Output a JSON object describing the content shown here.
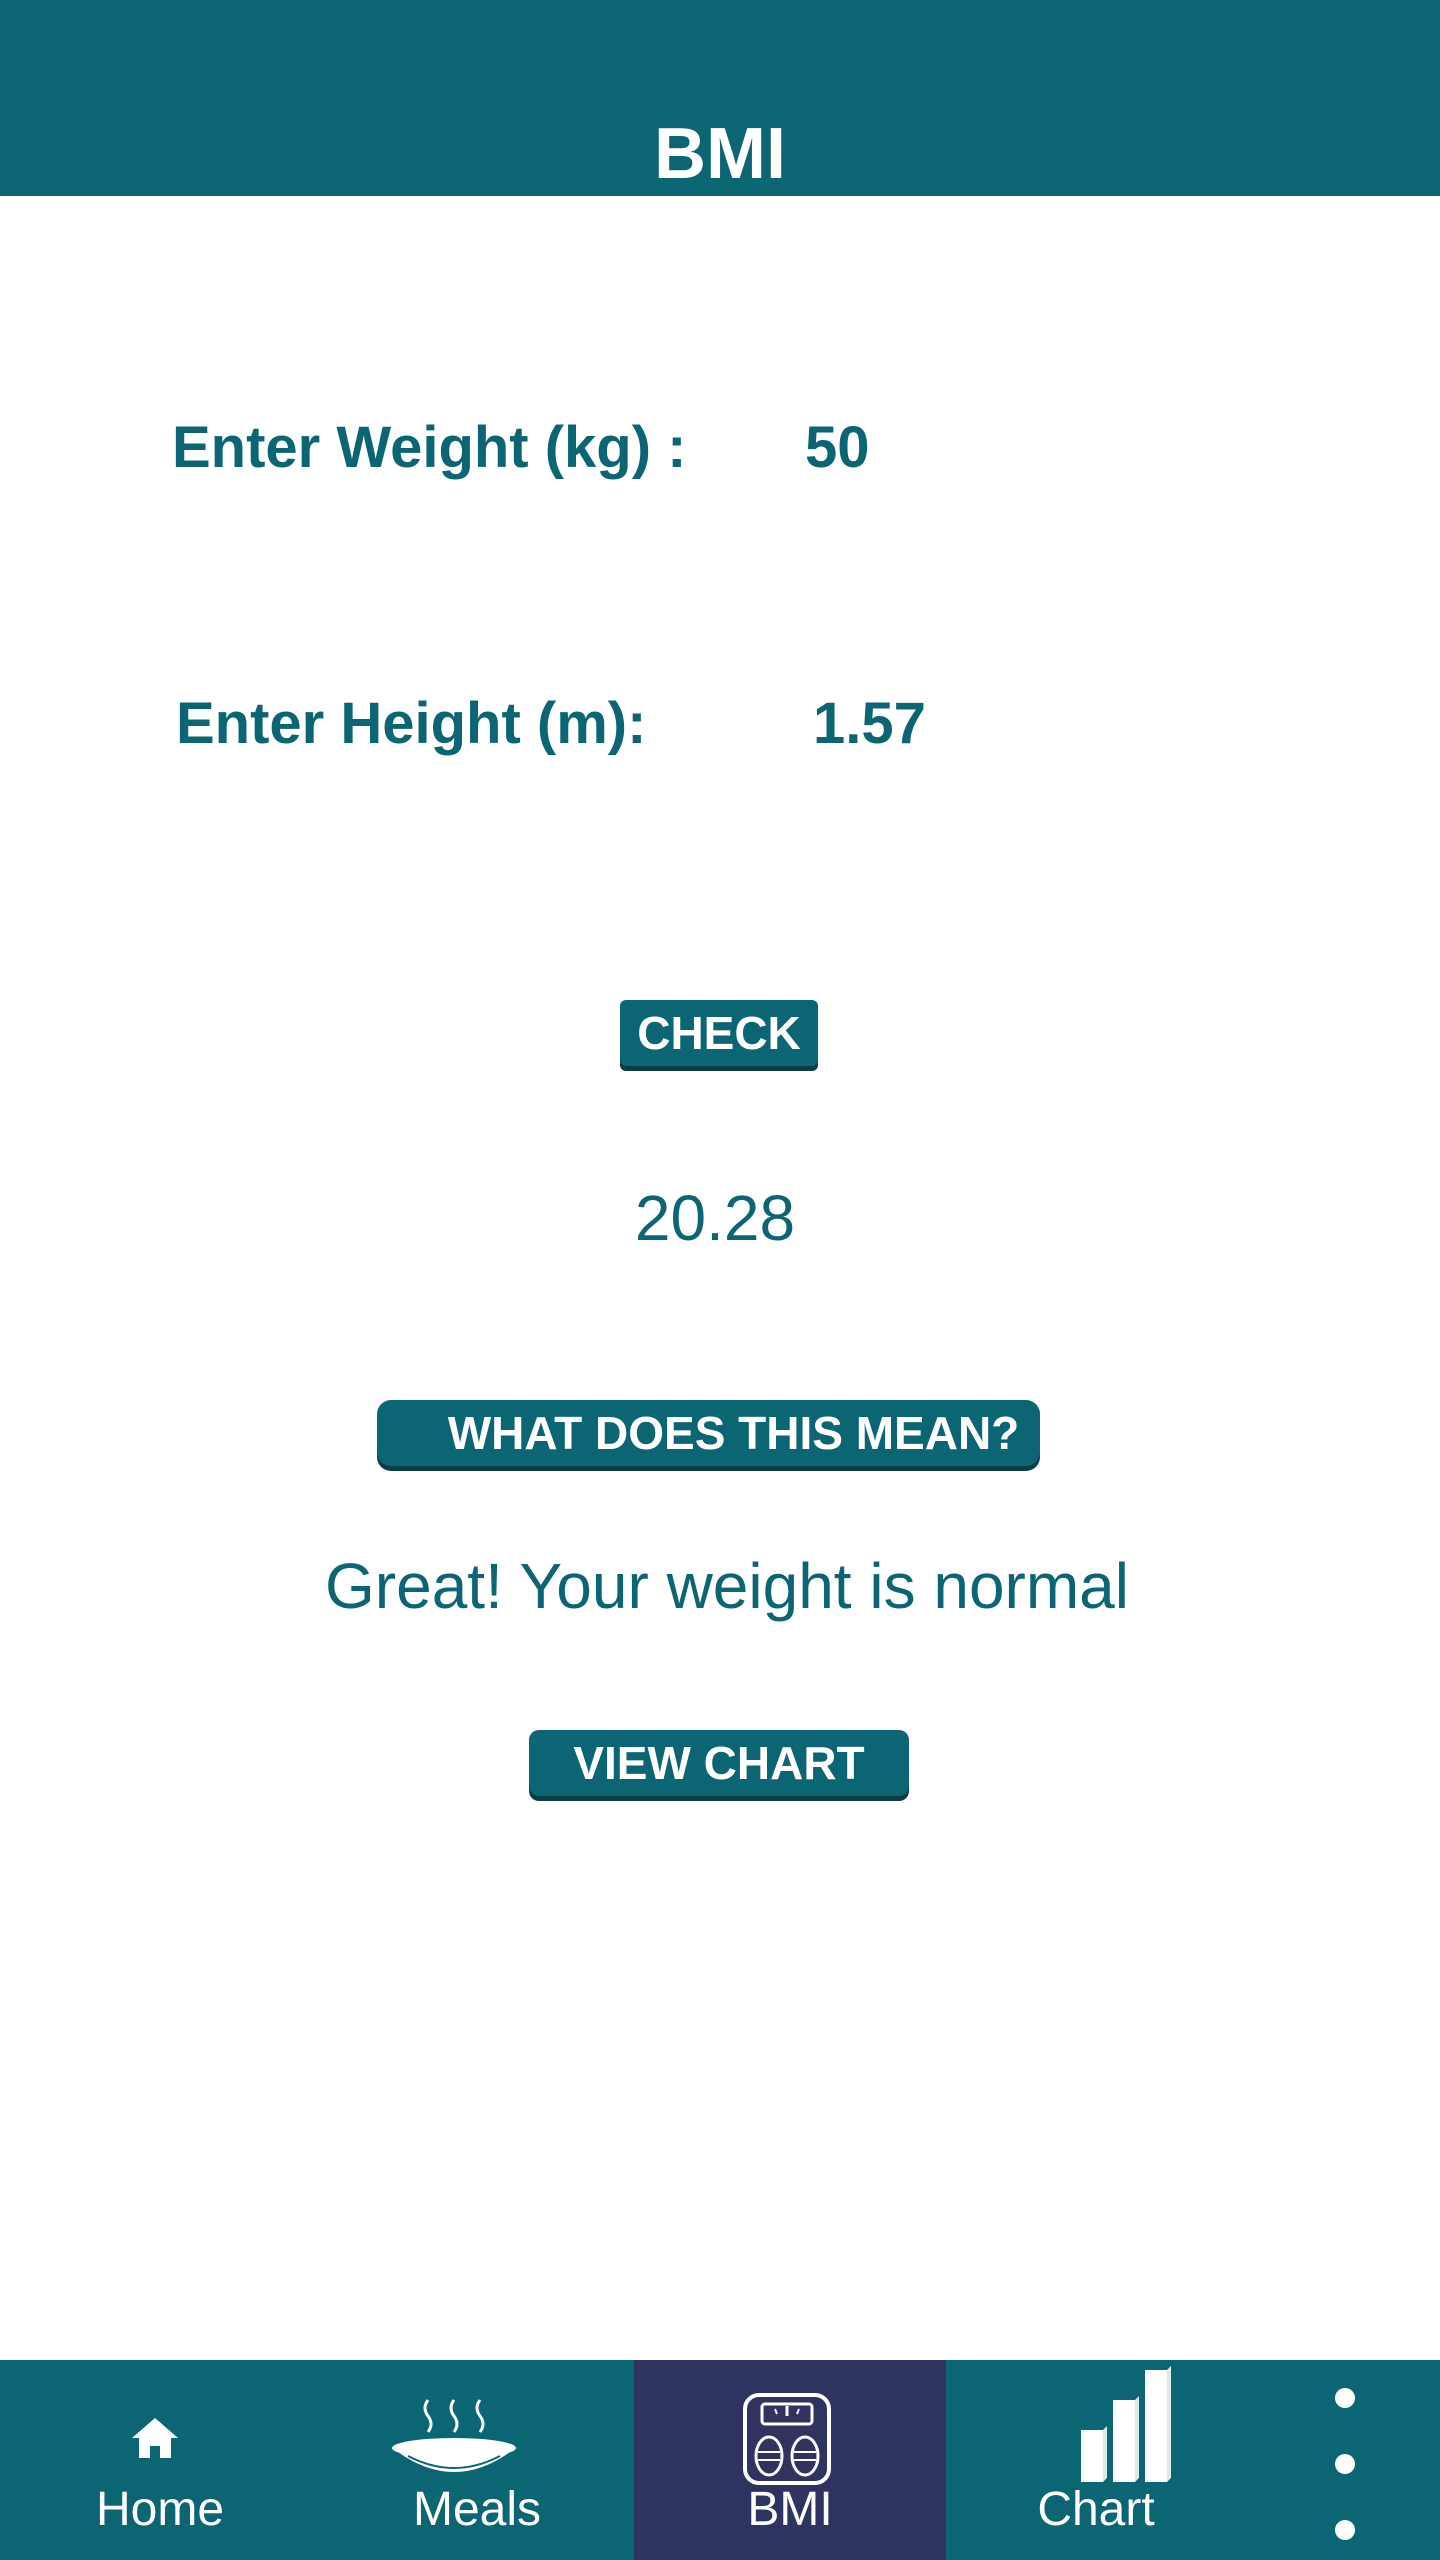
{
  "header": {
    "title": "BMI"
  },
  "form": {
    "weight_label": "Enter Weight (kg) :",
    "weight_value": "50",
    "height_label": "Enter Height (m):",
    "height_value": "1.57"
  },
  "buttons": {
    "check_label": "CHECK",
    "meaning_label": "WHAT DOES THIS MEAN?",
    "view_chart_label": "VIEW CHART"
  },
  "result": {
    "bmi_value": "20.28",
    "message": "Great! Your weight is normal"
  },
  "nav": {
    "items": [
      {
        "label": "Home",
        "icon": "home-icon"
      },
      {
        "label": "Meals",
        "icon": "meal-bowl-icon"
      },
      {
        "label": "BMI",
        "icon": "scale-icon",
        "active": true
      },
      {
        "label": "Chart",
        "icon": "bar-chart-icon"
      }
    ],
    "more_icon": "more-vertical-icon"
  },
  "colors": {
    "primary": "#0b6572",
    "nav_active": "#2e345f",
    "text_on_primary": "#ffffff",
    "background": "#ffffff"
  }
}
